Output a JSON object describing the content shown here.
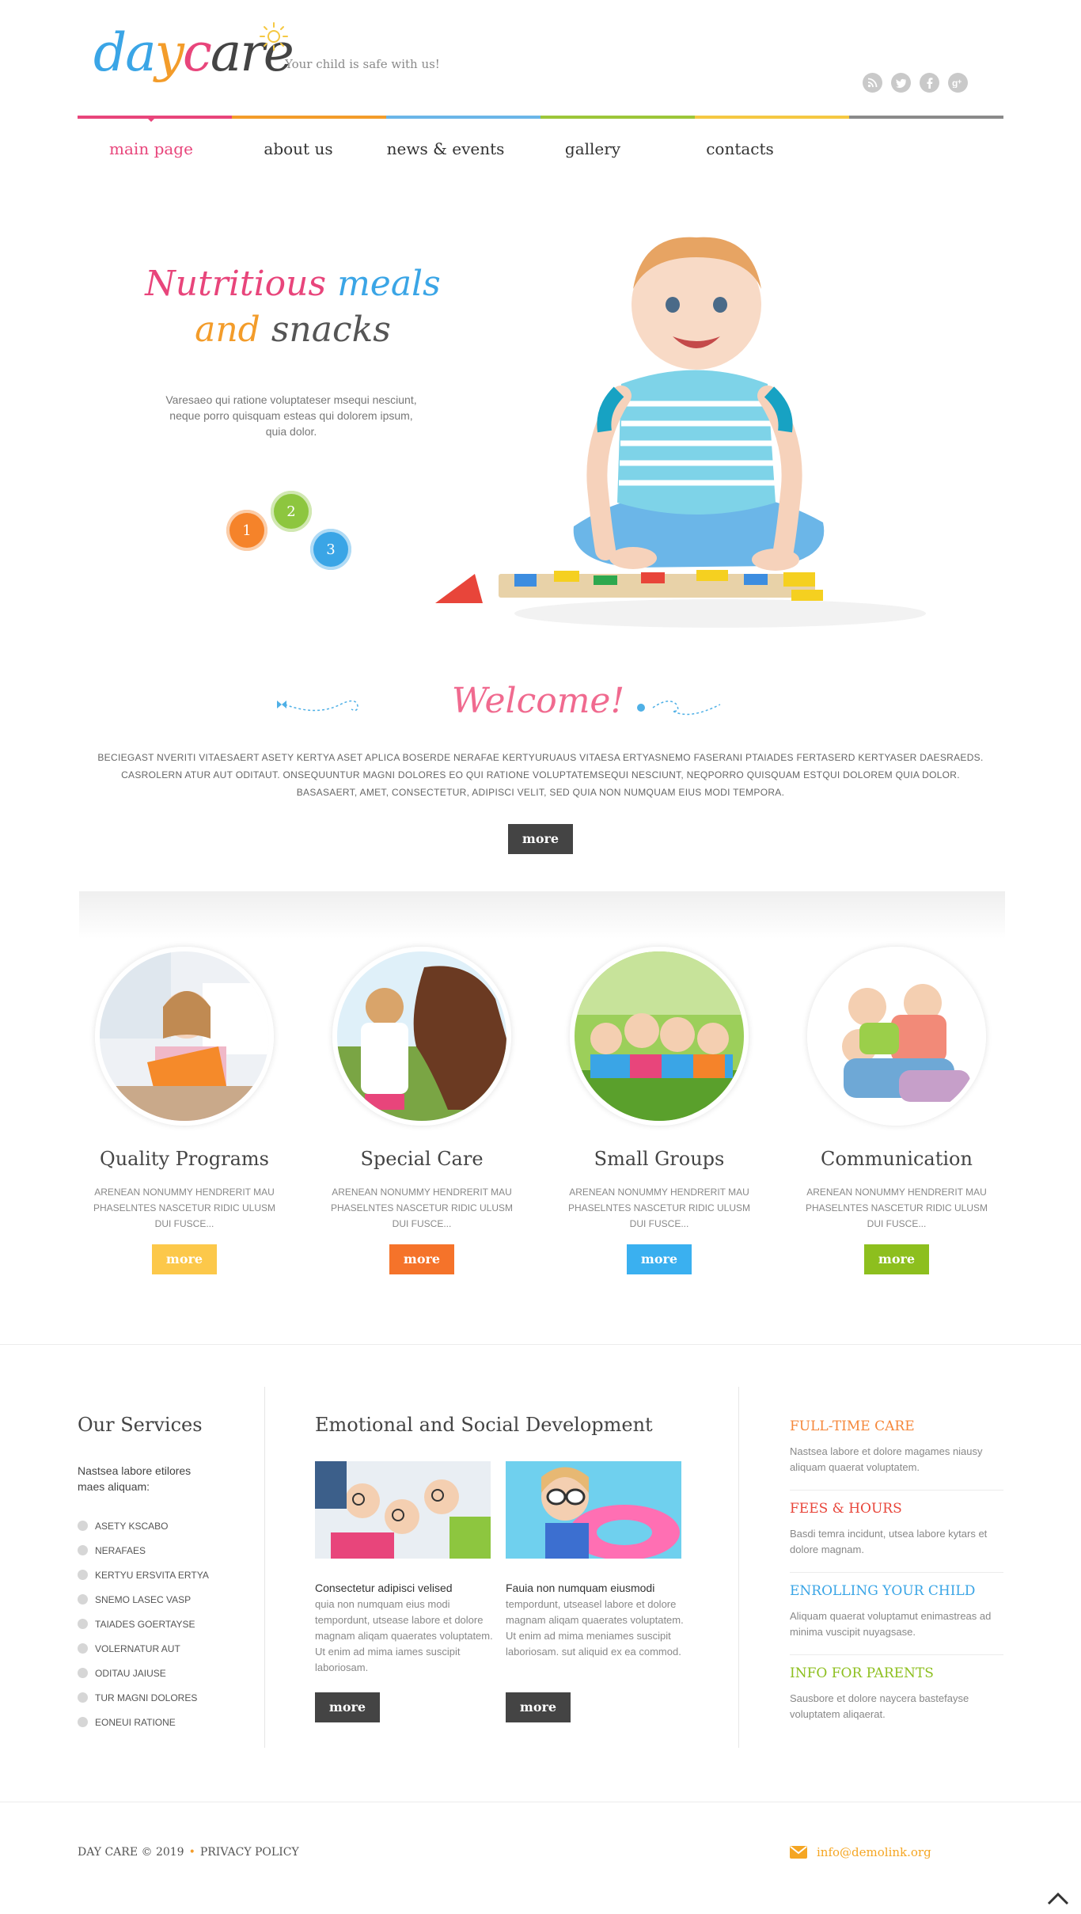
{
  "brand": {
    "logo_part1": "da",
    "logo_part2": "y",
    "logo_part3": "c",
    "logo_part4": "are",
    "tagline": "Your child is safe with us!"
  },
  "social": [
    "rss-icon",
    "twitter-icon",
    "facebook-icon",
    "google-plus-icon"
  ],
  "nav": {
    "items": [
      {
        "label": "main page",
        "active": true
      },
      {
        "label": "about us"
      },
      {
        "label": "news & events"
      },
      {
        "label": "gallery"
      },
      {
        "label": "contacts"
      }
    ],
    "bar_colors": [
      "#e8457b",
      "#f39c2a",
      "#6bb6e8",
      "#9cc63a",
      "#f5c842",
      "#8a8a8a"
    ]
  },
  "hero": {
    "title_w1": "Nutritious",
    "title_w2": "meals",
    "title_w3": "and",
    "title_w4": "snacks",
    "text": "Varesaeo qui ratione voluptateser msequi nesciunt, neque porro quisquam esteas qui dolorem ipsum, quia dolor.",
    "slides": [
      {
        "label": "1",
        "color": "#f5832a"
      },
      {
        "label": "2",
        "color": "#8dc63f"
      },
      {
        "label": "3",
        "color": "#3aa5e6"
      }
    ]
  },
  "welcome": {
    "title": "Welcome!",
    "text": "Beciegast nveriti vitaesaert asety kertya aset aplica boserde nerafae kertyuruaus vitaesa ertyasnemo faserani ptaiades fertaserd kertyaser daesraeds. Casrolern atur aut oditaut. Onsequuntur magni dolores eo qui ratione voluptatemsequi nesciunt, neqporro quisquam estqui dolorem quia dolor. Basasaert, amet, consectetur, adipisci velit, sed quia non numquam eius modi tempora.",
    "button": "more"
  },
  "features": [
    {
      "title": "Quality Programs",
      "text": "Arenean nonummy hendrerit mau phaselntes nascetur ridic ulusm dui fusce...",
      "button": "more",
      "color": "#fcc84a"
    },
    {
      "title": "Special Care",
      "text": "Arenean nonummy hendrerit mau phaselntes nascetur ridic ulusm dui fusce...",
      "button": "more",
      "color": "#f5732a"
    },
    {
      "title": "Small Groups",
      "text": "Arenean nonummy hendrerit mau phaselntes nascetur ridic ulusm dui fusce...",
      "button": "more",
      "color": "#3ab0f0"
    },
    {
      "title": "Communication",
      "text": "Arenean nonummy hendrerit mau phaselntes nascetur ridic ulusm dui fusce...",
      "button": "more",
      "color": "#8dbf1e"
    }
  ],
  "services": {
    "title": "Our Services",
    "intro": "Nastsea labore etilores maes aliquam:",
    "items": [
      "Asety kscabo",
      "Nerafaes",
      "Kertyu ersvita ertya",
      "Snemo lasec vasp",
      "Taiades goertayse",
      "Volernatur aut",
      "Oditau jaiuse",
      "Tur magni dolores",
      "Eoneui ratione"
    ]
  },
  "development": {
    "title": "Emotional and Social Development",
    "articles": [
      {
        "head": "Consectetur adipisci velised",
        "body": "quia non numquam eius modi tempordunt, utsease labore et dolore magnam aliqam quaerates voluptatem. Ut enim ad mima iames suscipit laboriosam.",
        "button": "more"
      },
      {
        "head": "Fauia non numquam eiusmodi",
        "body": "tempordunt, utseasel labore et dolore magnam aliqam quaerates voluptatem. Ut enim ad mima meniames suscipit laboriosam. sut aliquid ex ea commod.",
        "button": "more"
      }
    ]
  },
  "info": [
    {
      "title": "Full-time care",
      "text": "Nastsea labore et dolore magames niausy aliquam quaerat voluptatem.",
      "color": "#f5873a"
    },
    {
      "title": "Fees & hours",
      "text": "Basdi temra incidunt, utsea labore kytars et dolore magnam.",
      "color": "#e8453a"
    },
    {
      "title": "Enrolling your child",
      "text": "Aliquam quaerat voluptamut enimastreas ad minima vuscipit nuyagsase.",
      "color": "#3aa5e6"
    },
    {
      "title": "Info for parents",
      "text": "Sausbore et dolore naycera bastefayse voluptatem aliqaerat.",
      "color": "#8dbf1e"
    }
  ],
  "footer": {
    "copyright": "Day Care © 2019",
    "privacy": "Privacy Policy",
    "email": "info@demolink.org"
  }
}
